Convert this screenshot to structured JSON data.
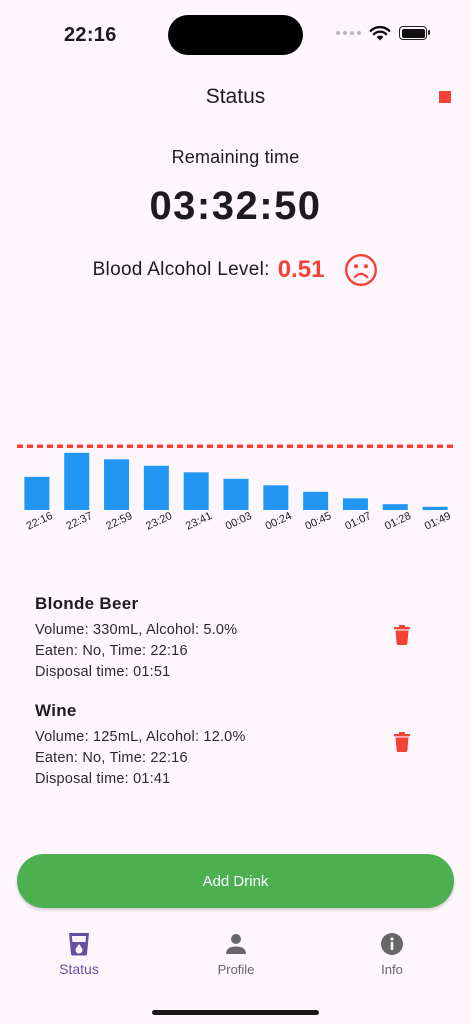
{
  "status_bar": {
    "time": "22:16"
  },
  "header": {
    "title": "Status"
  },
  "remaining": {
    "label": "Remaining time",
    "value": "03:32:50"
  },
  "bal": {
    "label": "Blood Alcohol Level:",
    "value": "0.51",
    "value_color": "#f44336"
  },
  "chart_data": {
    "type": "bar",
    "categories": [
      "22:16",
      "22:37",
      "22:59",
      "23:20",
      "23:41",
      "00:03",
      "00:24",
      "00:45",
      "01:07",
      "01:28",
      "01:49"
    ],
    "values": [
      0.51,
      0.88,
      0.78,
      0.68,
      0.58,
      0.48,
      0.38,
      0.28,
      0.18,
      0.09,
      0.05
    ],
    "ylim": [
      0,
      1.0
    ],
    "threshold": 0.98,
    "bar_color": "#2196f3",
    "threshold_color": "#f44336",
    "title": "",
    "xlabel": "",
    "ylabel": ""
  },
  "drinks": [
    {
      "name": "Blonde Beer",
      "line1": "Volume: 330mL, Alcohol: 5.0%",
      "line2": "Eaten: No, Time: 22:16",
      "line3": "Disposal time: 01:51"
    },
    {
      "name": "Wine",
      "line1": "Volume: 125mL, Alcohol: 12.0%",
      "line2": "Eaten: No, Time: 22:16",
      "line3": "Disposal time: 01:41"
    }
  ],
  "add_button": {
    "label": "Add Drink"
  },
  "nav": [
    {
      "label": "Status",
      "icon": "glass-icon",
      "active": true
    },
    {
      "label": "Profile",
      "icon": "person-icon",
      "active": false
    },
    {
      "label": "Info",
      "icon": "info-icon",
      "active": false
    }
  ],
  "colors": {
    "accent": "#6750a4",
    "danger": "#f44336",
    "button": "#4caf50",
    "bar": "#2196f3"
  }
}
